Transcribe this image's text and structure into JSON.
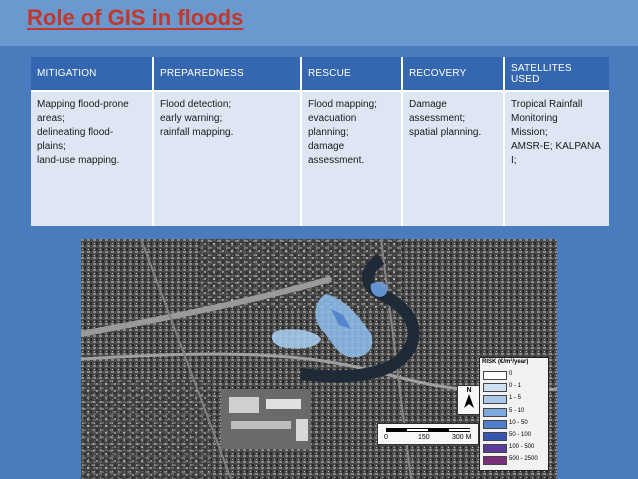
{
  "slide": {
    "title": "Role of GIS in floods"
  },
  "table": {
    "headers": [
      "MITIGATION",
      "PREPAREDNESS",
      "RESCUE",
      "RECOVERY",
      "SATELLITES USED"
    ],
    "cells": [
      [
        "Mapping flood-prone",
        "areas;",
        "delineating flood-",
        "plains;",
        "land-use mapping."
      ],
      [
        "Flood detection;",
        "early warning;",
        "rainfall mapping."
      ],
      [
        "Flood mapping;",
        "evacuation",
        "planning;",
        "damage",
        "assessment."
      ],
      [
        "Damage",
        "assessment;",
        "spatial planning."
      ],
      [
        "Tropical Rainfall",
        "Monitoring",
        "Mission;",
        "AMSR-E; KALPANA",
        "I;"
      ]
    ]
  },
  "map": {
    "legend_title": "RISK (€/m²/year)",
    "legend_items": [
      {
        "label": "0",
        "color": "#ffffff"
      },
      {
        "label": "0 - 1",
        "color": "#cfe0f3"
      },
      {
        "label": "1 - 5",
        "color": "#a9c8ea"
      },
      {
        "label": "5 - 10",
        "color": "#7ea9dc"
      },
      {
        "label": "10 - 50",
        "color": "#4f7fcc"
      },
      {
        "label": "50 - 100",
        "color": "#3556b3"
      },
      {
        "label": "100 - 500",
        "color": "#5a3a9a"
      },
      {
        "label": "500 - 2500",
        "color": "#7a2f78"
      }
    ],
    "scale_labels": [
      "0",
      "150",
      "300 M"
    ],
    "north_label": "N"
  }
}
